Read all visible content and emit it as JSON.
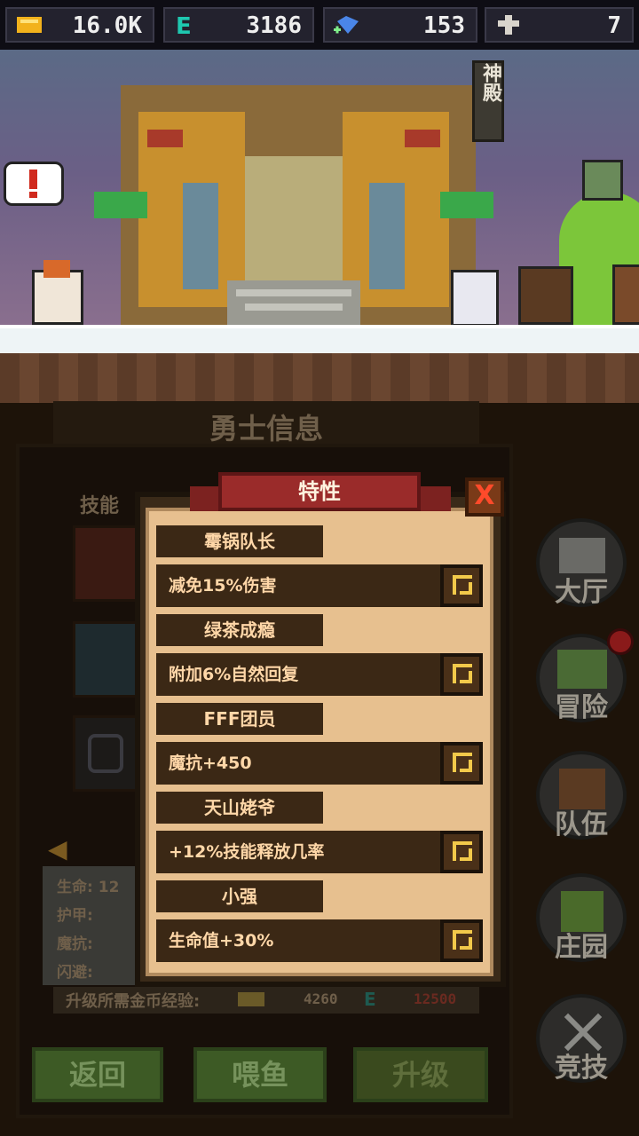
{
  "resources": {
    "gold": "16.0K",
    "energy": "3186",
    "gems": "153",
    "cross": "7"
  },
  "scene": {
    "temple_sign": "神殿"
  },
  "hero_panel": {
    "title": "勇士信息",
    "skills_tab": "技能",
    "stats": {
      "hp_label": "生命:",
      "hp_value": "12",
      "armor_label": "护甲:",
      "magic_resist_label": "魔抗:",
      "dodge_label": "闪避:"
    },
    "upgrade_cost_label": "升级所需金币经验:",
    "upgrade_gold": "4260",
    "upgrade_energy": "12500"
  },
  "bottom_buttons": {
    "back": "返回",
    "feed": "喂鱼",
    "upgrade": "升级"
  },
  "side_nav": {
    "hall": "大厅",
    "adventure": "冒险",
    "team": "队伍",
    "manor": "庄园",
    "arena": "竞技"
  },
  "modal": {
    "title": "特性",
    "close": "X",
    "traits": [
      {
        "name": "霉锅队长",
        "desc": "减免15%伤害"
      },
      {
        "name": "绿茶成瘾",
        "desc": "附加6%自然回复"
      },
      {
        "name": "FFF团员",
        "desc": "魔抗+450"
      },
      {
        "name": "天山姥爷",
        "desc": "+12%技能释放几率"
      },
      {
        "name": "小强",
        "desc": "生命值+30%"
      }
    ]
  }
}
